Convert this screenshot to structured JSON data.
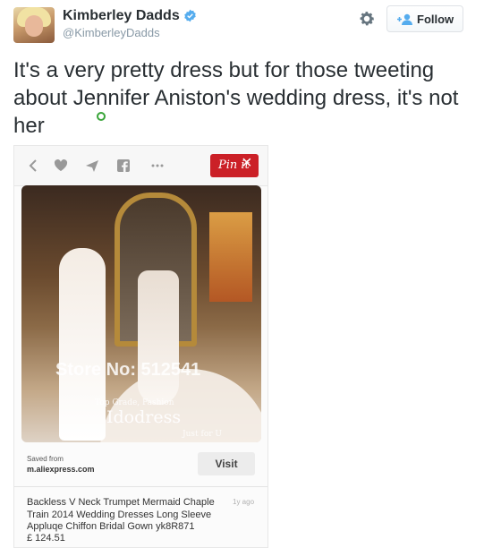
{
  "user": {
    "name": "Kimberley Dadds",
    "handle": "@KimberleyDadds"
  },
  "follow_button": {
    "label": "Follow"
  },
  "tweet": {
    "text": "It's a very pretty dress but for those tweeting about Jennifer Aniston's wedding dress, it's not her"
  },
  "embedded_pin": {
    "pin_button_label": "Pin it",
    "watermark": {
      "store": "Store No: 512541",
      "top": "Top Grade, Fashion",
      "brand": "Idodress",
      "just": "Just for U"
    },
    "saved_from_label": "Saved from",
    "saved_from_domain": "m.aliexpress.com",
    "visit_label": "Visit",
    "description": "Backless V Neck Trumpet Mermaid Chaple Train 2014 Wedding Dresses Long Sleeve Appluqe Chiffon Bridal Gown yk8R871",
    "age": "1y ago",
    "price": "£ 124.51"
  },
  "colors": {
    "accent": "#55acee",
    "text": "#292f33",
    "muted": "#8899a6",
    "pin_red": "#cb2027"
  },
  "icons": [
    "verified-badge-icon",
    "gear-icon",
    "add-user-icon",
    "back-chevron-icon",
    "heart-icon",
    "send-icon",
    "facebook-icon",
    "more-icon",
    "close-icon"
  ]
}
